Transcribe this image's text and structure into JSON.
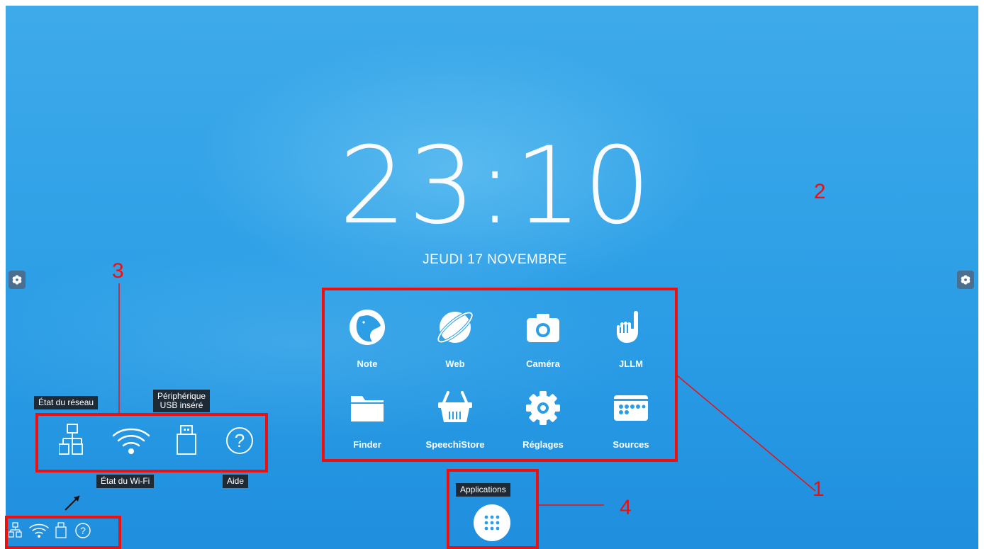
{
  "clock": {
    "time": "23:10",
    "date": "JEUDI 17 NOVEMBRE"
  },
  "apps": [
    {
      "label": "Note",
      "icon": "note-icon"
    },
    {
      "label": "Web",
      "icon": "web-icon"
    },
    {
      "label": "Caméra",
      "icon": "camera-icon"
    },
    {
      "label": "JLLM",
      "icon": "hand-icon"
    },
    {
      "label": "Finder",
      "icon": "folder-icon"
    },
    {
      "label": "SpeechiStore",
      "icon": "basket-icon"
    },
    {
      "label": "Réglages",
      "icon": "gear-icon"
    },
    {
      "label": "Sources",
      "icon": "sources-icon"
    }
  ],
  "tray": {
    "network_tooltip": "État du réseau",
    "usb_tooltip_line1": "Périphérique",
    "usb_tooltip_line2": "USB inséré",
    "wifi_tooltip": "État du Wi-Fi",
    "help_tooltip": "Aide",
    "help_glyph": "?"
  },
  "applications_tooltip": "Applications",
  "annotations": {
    "n1": "1",
    "n2": "2",
    "n3": "3",
    "n4": "4"
  },
  "colors": {
    "annotation": "#ee0f0f",
    "background": "#2c9ee6",
    "tooltip": "#1e2a36"
  }
}
